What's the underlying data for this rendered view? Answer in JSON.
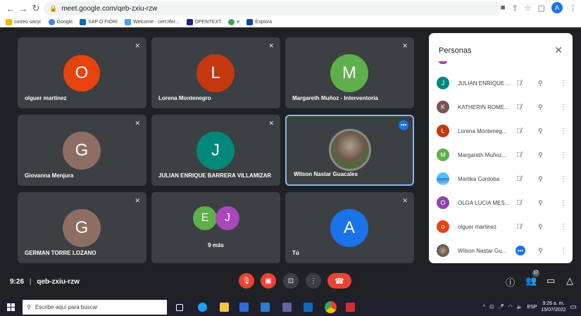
{
  "browser": {
    "url": "meet.google.com/qeb-zxiu-rzw",
    "profile_initial": "A",
    "bookmarks": [
      {
        "label": "correo sacyr",
        "color": "#f4b400"
      },
      {
        "label": "Google",
        "color": "#4285f4"
      },
      {
        "label": "SAP O FIORI",
        "color": "#1565c0"
      },
      {
        "label": "Welcome - cert.lifer...",
        "color": "#42a5f5"
      },
      {
        "label": "OPENTEXT",
        "color": "#1a237e"
      },
      {
        "label": "e",
        "color": "#43a047"
      },
      {
        "label": "Explora",
        "color": "#0d47a1"
      }
    ]
  },
  "tiles": [
    {
      "name": "olguer martinez",
      "initial": "O",
      "color": "#e8430e"
    },
    {
      "name": "Lorena Montenegro",
      "initial": "L",
      "color": "#c5380f"
    },
    {
      "name": "Margareth Muñoz - Interventoria",
      "initial": "M",
      "color": "#5eb04a"
    },
    {
      "name": "Giovanna Menjura",
      "initial": "G",
      "color": "#8d6e63"
    },
    {
      "name": "JULIAN ENRIQUE BARRERA VILLAMIZAR",
      "initial": "J",
      "color": "#00897b"
    },
    {
      "name": "Wilson Nastar Guacales",
      "initial": "",
      "color": "#9e9e9e"
    },
    {
      "name": "GERMAN TORRE LOZANO",
      "initial": "G",
      "color": "#8d6e63"
    },
    {
      "name": "9 más",
      "initials": [
        "E",
        "J"
      ],
      "colors": [
        "#5eb04a",
        "#ab47bc"
      ]
    },
    {
      "name": "Tú",
      "initial": "A",
      "color": "#1a73e8"
    }
  ],
  "panel": {
    "title": "Personas",
    "people": [
      {
        "name": "JULIAN ENRIQUE ...",
        "initial": "J",
        "color": "#00897b"
      },
      {
        "name": "KATHERIN ROME...",
        "initial": "K",
        "color": "#795548"
      },
      {
        "name": "Lorena Monteneg...",
        "initial": "L",
        "color": "#c5380f"
      },
      {
        "name": "Margareth Muñoz...",
        "initial": "M",
        "color": "#5eb04a"
      },
      {
        "name": "Martika Cordoba",
        "initial": "",
        "color": "#4fc3f7"
      },
      {
        "name": "OLGA LUCIA MES...",
        "initial": "O",
        "color": "#8e44ad"
      },
      {
        "name": "olguer martinez",
        "initial": "o",
        "color": "#e8430e"
      },
      {
        "name": "Wilson Nastar Gu...",
        "initial": "",
        "color": "#9e9e9e"
      }
    ]
  },
  "meeting": {
    "time": "9:26",
    "code": "qeb-zxiu-rzw",
    "participants_count": "17"
  },
  "taskbar": {
    "search_placeholder": "Escribe aquí para buscar",
    "lang": "ESP",
    "time": "9:26 a. m.",
    "date": "15/07/2022"
  }
}
